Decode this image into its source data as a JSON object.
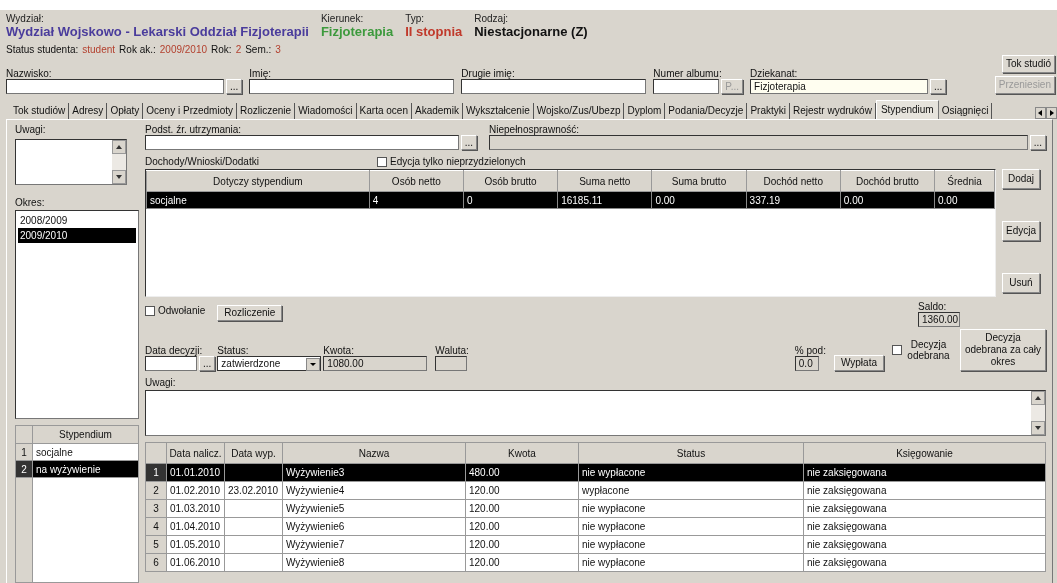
{
  "header": {
    "fields": [
      {
        "label": "Wydział:",
        "value": "Wydział Wojskowo - Lekarski Oddział Fizjoterapii",
        "color": "#4a3c9c"
      },
      {
        "label": "Kierunek:",
        "value": "Fizjoterapia",
        "color": "#3d9a3d"
      },
      {
        "label": "Typ:",
        "value": "II stopnia",
        "color": "#c0392b"
      },
      {
        "label": "Rodzaj:",
        "value": "Niestacjonarne (Z)",
        "color": "#111111"
      }
    ]
  },
  "status_line": [
    {
      "label": "Status studenta:",
      "value": "student"
    },
    {
      "label": "Rok ak.:",
      "value": "2009/2010"
    },
    {
      "label": "Rok:",
      "value": "2"
    },
    {
      "label": "Sem.:",
      "value": "3"
    }
  ],
  "student_fields": [
    {
      "label": "Nazwisko:",
      "button": "..."
    },
    {
      "label": "Imię:"
    },
    {
      "label": "Drugie imię:"
    },
    {
      "label": "Numer albumu:",
      "button": "P...",
      "button_disabled": true
    },
    {
      "label": "Dziekanat:",
      "value": "Fizjoterapia",
      "button": "..."
    }
  ],
  "side_buttons": [
    {
      "label": "Tok studió",
      "disabled": false
    },
    {
      "label": "Przeniesien",
      "disabled": true
    }
  ],
  "tabs": [
    {
      "label": "Tok studiów",
      "selected": false
    },
    {
      "label": "Adresy",
      "selected": false
    },
    {
      "label": "Opłaty",
      "selected": false
    },
    {
      "label": "Oceny i Przedmioty",
      "selected": false
    },
    {
      "label": "Rozliczenie",
      "selected": false
    },
    {
      "label": "Wiadomości",
      "selected": false
    },
    {
      "label": "Karta ocen",
      "selected": false
    },
    {
      "label": "Akademik",
      "selected": false
    },
    {
      "label": "Wykształcenie",
      "selected": false
    },
    {
      "label": "Wojsko/Zus/Ubezp",
      "selected": false
    },
    {
      "label": "Dyplom",
      "selected": false
    },
    {
      "label": "Podania/Decyzje",
      "selected": false
    },
    {
      "label": "Praktyki",
      "selected": false
    },
    {
      "label": "Rejestr wydruków",
      "selected": false
    },
    {
      "label": "Stypendium",
      "selected": true
    },
    {
      "label": "Osiągnięci",
      "selected": false
    }
  ],
  "left": {
    "notes_label": "Uwagi:",
    "period_label": "Okres:",
    "periods": [
      {
        "label": "2008/2009",
        "selected": false
      },
      {
        "label": "2009/2010",
        "selected": true
      }
    ],
    "scholarships": {
      "header": "Stypendium",
      "rows": [
        {
          "no": "1",
          "name": "socjalne",
          "selected": false
        },
        {
          "no": "2",
          "name": "na wyżywienie",
          "selected": true
        }
      ]
    }
  },
  "support": {
    "label": "Podst. źr. utrzymania:",
    "button": "..."
  },
  "disability": {
    "label": "Niepełnosprawność:",
    "button": "..."
  },
  "income": {
    "label": "Dochody/Wnioski/Dodatki",
    "unassigned_only": {
      "label": "Edycja tylko nieprzydzielonych",
      "checked": false
    },
    "columns": [
      "Dotyczy stypendium",
      "Osób netto",
      "Osób brutto",
      "Suma netto",
      "Suma brutto",
      "Dochód netto",
      "Dochód brutto",
      "Średnia"
    ],
    "rows": [
      {
        "cells": [
          "socjalne",
          "4",
          "0",
          "16185.11",
          "0.00",
          "337.19",
          "0.00",
          "0.00"
        ],
        "selected": true
      }
    ]
  },
  "income_buttons": [
    "Dodaj",
    "Edycja",
    "Usuń"
  ],
  "appeal": {
    "label": "Odwołanie",
    "checked": false
  },
  "settlement_button": "Rozliczenie",
  "balance": {
    "label": "Saldo:",
    "value": "1360.00"
  },
  "decision_date": {
    "label": "Data decyzji:",
    "button": "..."
  },
  "status": {
    "label": "Status:",
    "value": "zatwierdzone"
  },
  "amount": {
    "label": "Kwota:",
    "value": "1080.00"
  },
  "currency": {
    "label": "Waluta:"
  },
  "percent": {
    "label": "% pod:",
    "value": "0.0"
  },
  "payout_button": "Wypłata",
  "decision_received": {
    "label": "Decyzja odebrana",
    "checked": false
  },
  "decision_period_button": "Decyzja odebrana za cały okres",
  "notes_label": "Uwagi:",
  "payments": {
    "columns": [
      "Data nalicz.",
      "Data wyp.",
      "Nazwa",
      "Kwota",
      "Status",
      "Księgowanie"
    ],
    "rows": [
      {
        "no": "1",
        "date": "01.01.2010",
        "name": "Wyżywienie3",
        "amount": "480.00",
        "status": "nie wypłacone",
        "booking": "nie zaksięgowana",
        "selected": true
      },
      {
        "no": "2",
        "date": "01.02.2010",
        "paid_date": "23.02.2010",
        "name": "Wyżywienie4",
        "amount": "120.00",
        "status": "wypłacone",
        "booking": "nie zaksięgowana",
        "selected": false
      },
      {
        "no": "3",
        "date": "01.03.2010",
        "name": "Wyżywienie5",
        "amount": "120.00",
        "status": "nie wypłacone",
        "booking": "nie zaksięgowana",
        "selected": false
      },
      {
        "no": "4",
        "date": "01.04.2010",
        "name": "Wyżywienie6",
        "amount": "120.00",
        "status": "nie wypłacone",
        "booking": "nie zaksięgowana",
        "selected": false
      },
      {
        "no": "5",
        "date": "01.05.2010",
        "name": "Wyżywienie7",
        "amount": "120.00",
        "status": "nie wypłacone",
        "booking": "nie zaksięgowana",
        "selected": false
      },
      {
        "no": "6",
        "date": "01.06.2010",
        "name": "Wyżywienie8",
        "amount": "120.00",
        "status": "nie wypłacone",
        "booking": "nie zaksięgowana",
        "selected": false
      }
    ]
  }
}
